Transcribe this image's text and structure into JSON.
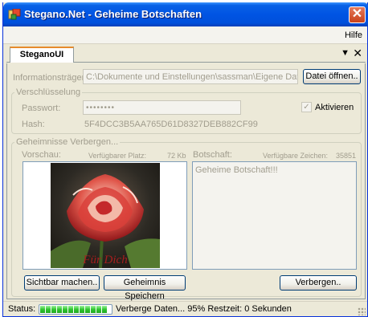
{
  "window": {
    "title": "Stegano.Net - Geheime Botschaften"
  },
  "menu": {
    "help": "Hilfe"
  },
  "tabs": [
    {
      "label": "SteganoUI"
    }
  ],
  "carrier": {
    "label": "Informationsträger:",
    "path": "C:\\Dokumente und Einstellungen\\sassman\\Eigene Dateien\\E",
    "open_button": "Datei öffnen.."
  },
  "encryption": {
    "group_title": "Verschlüsselung",
    "password_label": "Passwort:",
    "password_value": "••••••••",
    "activate_label": "Aktivieren",
    "activate_checked": true,
    "hash_label": "Hash:",
    "hash_value": "5F4DCC3B5AA765D61D8327DEB882CF99"
  },
  "hide": {
    "group_title": "Geheimnisse Verbergen...",
    "preview_label": "Vorschau:",
    "available_space_label": "Verfügbarer Platz:",
    "available_space_value": "72 Kb",
    "message_label": "Botschaft:",
    "available_chars_label": "Verfügbare Zeichen:",
    "available_chars_value": "35851",
    "message_text": "Geheime Botschaft!!!",
    "image_caption": "Für Dich",
    "visible_button": "Sichtbar machen..",
    "save_secret_button": "Geheimnis Speichern",
    "hide_button": "Verbergen.."
  },
  "status": {
    "label": "Status:",
    "progress": 0.95,
    "text": "Verberge Daten... 95% Restzeit: 0 Sekunden"
  },
  "colors": {
    "title_blue": "#0054e3",
    "progress_green": "#2fc52f",
    "rose_red": "#c0282b"
  },
  "icons": [
    "app-icon",
    "close-icon",
    "tab-dropdown-icon",
    "tab-close-icon",
    "check-icon",
    "resize-grip-icon"
  ]
}
